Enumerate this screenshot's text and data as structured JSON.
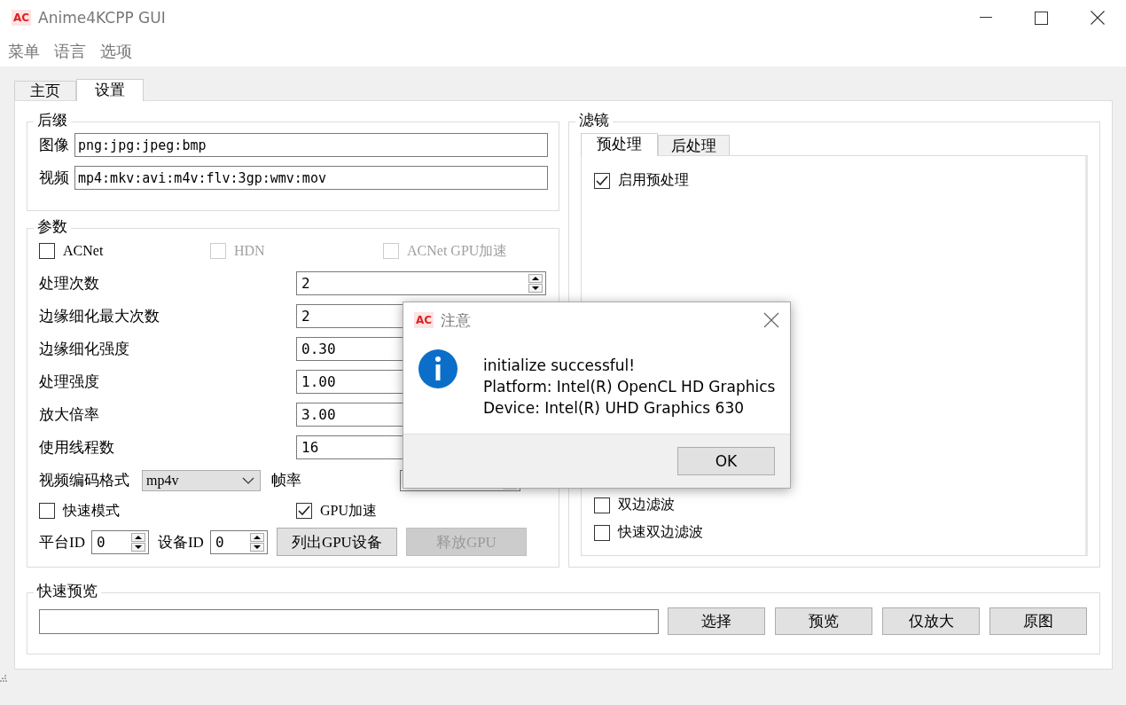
{
  "window": {
    "logo": "AC",
    "title": "Anime4KCPP GUI"
  },
  "menu": [
    {
      "label": "菜单"
    },
    {
      "label": "语言"
    },
    {
      "label": "选项"
    }
  ],
  "tabs": [
    {
      "label": "主页",
      "selected": false
    },
    {
      "label": "设置",
      "selected": true
    }
  ],
  "suffix": {
    "title": "后缀",
    "fields": [
      {
        "label": "图像",
        "value": "png:jpg:jpeg:bmp"
      },
      {
        "label": "视频",
        "value": "mp4:mkv:avi:m4v:flv:3gp:wmv:mov"
      }
    ]
  },
  "params": {
    "title": "参数",
    "options": [
      {
        "label": "ACNet",
        "checked": false,
        "disabled": false
      },
      {
        "label": "HDN",
        "checked": false,
        "disabled": true
      },
      {
        "label": "ACNet GPU加速",
        "checked": false,
        "disabled": true
      }
    ],
    "spin_rows": [
      {
        "label": "处理次数",
        "value": "2"
      },
      {
        "label": "边缘细化最大次数",
        "value": "2"
      },
      {
        "label": "边缘细化强度",
        "value": "0.30"
      },
      {
        "label": "处理强度",
        "value": "1.00"
      },
      {
        "label": "放大倍率",
        "value": "3.00"
      },
      {
        "label": "使用线程数",
        "value": "16"
      }
    ],
    "codec": {
      "label": "视频编码格式",
      "value": "mp4v"
    },
    "fps": {
      "label": "帧率"
    },
    "checks": [
      {
        "label": "快速模式",
        "checked": false
      },
      {
        "label": "GPU加速",
        "checked": true
      }
    ],
    "ids": [
      {
        "label": "平台ID",
        "value": "0"
      },
      {
        "label": "设备ID",
        "value": "0"
      }
    ],
    "buttons": [
      {
        "label": "列出GPU设备",
        "disabled": false
      },
      {
        "label": "释放GPU",
        "disabled": true
      }
    ]
  },
  "filters": {
    "title": "滤镜",
    "tabs": [
      {
        "label": "预处理",
        "selected": true
      },
      {
        "label": "后处理",
        "selected": false
      }
    ],
    "top_items": [
      {
        "label": "启用预处理",
        "checked": true
      }
    ],
    "bottom_items": [
      {
        "label": "双边滤波",
        "checked": false
      },
      {
        "label": "快速双边滤波",
        "checked": false
      }
    ]
  },
  "preview": {
    "title": "快速预览",
    "buttons": [
      {
        "label": "选择"
      },
      {
        "label": "预览"
      },
      {
        "label": "仅放大"
      },
      {
        "label": "原图"
      }
    ]
  },
  "dialog": {
    "logo": "AC",
    "title": "注意",
    "lines": [
      "initialize successful!",
      "Platform: Intel(R) OpenCL HD Graphics",
      "Device: Intel(R) UHD Graphics 630"
    ],
    "button": "OK"
  }
}
